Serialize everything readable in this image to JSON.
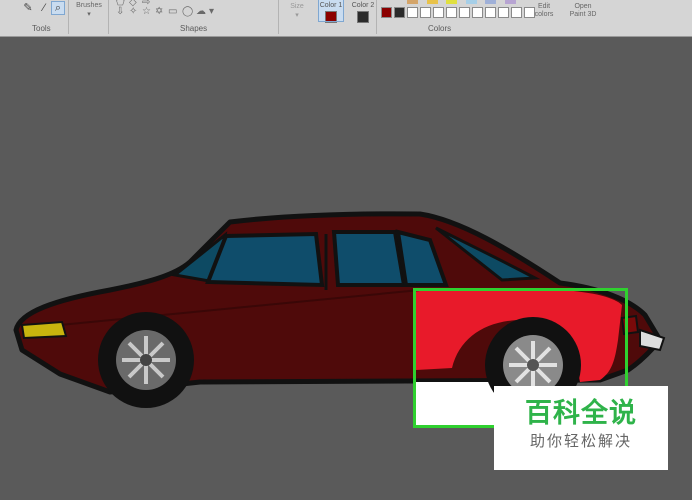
{
  "ribbon": {
    "tools": {
      "group_label": "Tools",
      "icons": [
        "eraser-icon",
        "color-picker-icon",
        "magnifier-icon"
      ]
    },
    "brushes": {
      "label": "Brushes"
    },
    "shapes": {
      "group_label": "Shapes"
    },
    "size": {
      "label": "Size"
    },
    "colors": {
      "group_label": "Colors",
      "color1_label": "Color 1",
      "color2_label": "Color 2",
      "color1_value": "#8b0000",
      "color2_value": "#2b2b2b",
      "edit_label": "Edit colors",
      "paint3d_label": "Open Paint 3D",
      "palette_top": [
        "#d4a56a",
        "#e8c24a",
        "#e0e040",
        "#a6cfe8",
        "#9fb0d8",
        "#b7a4d2"
      ],
      "palette_bottom": [
        "#ffffff",
        "#ffffff",
        "#ffffff",
        "#ffffff",
        "#ffffff",
        "#ffffff",
        "#ffffff",
        "#ffffff",
        "#ffffff",
        "#ffffff"
      ]
    }
  },
  "canvas": {
    "drawing": "red-sedan-car",
    "selection_color": "#2fd12f"
  },
  "watermark": {
    "title": "百科全说",
    "subtitle": "助你轻松解决"
  }
}
